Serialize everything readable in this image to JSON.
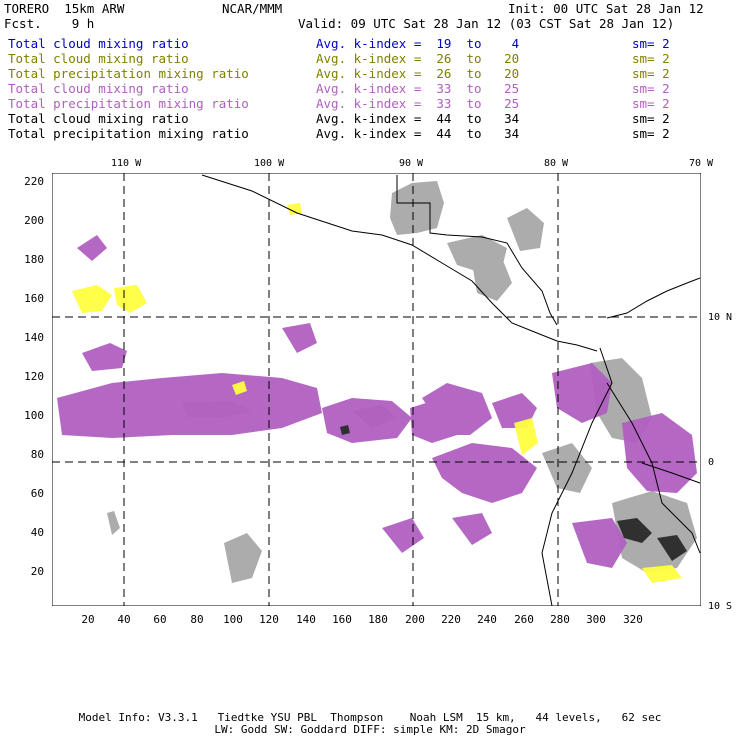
{
  "header": {
    "model": "TORERO  15km ARW",
    "center": "NCAR/MMM",
    "init": "Init: 00 UTC Sat 28 Jan 12",
    "fcst": "Fcst.    9 h",
    "valid": "Valid: 09 UTC Sat 28 Jan 12 (03 CST Sat 28 Jan 12)"
  },
  "legend": [
    {
      "name": "Total cloud mixing ratio",
      "stat": "Avg. k-index =  19  to    4",
      "sm": "sm= 2",
      "color": "#0000cc"
    },
    {
      "name": "Total cloud mixing ratio",
      "stat": "Avg. k-index =  26  to   20",
      "sm": "sm= 2",
      "color": "#808000"
    },
    {
      "name": "Total precipitation mixing ratio",
      "stat": "Avg. k-index =  26  to   20",
      "sm": "sm= 2",
      "color": "#808000"
    },
    {
      "name": "Total cloud mixing ratio",
      "stat": "Avg. k-index =  33  to   25",
      "sm": "sm= 2",
      "color": "#b060c0"
    },
    {
      "name": "Total precipitation mixing ratio",
      "stat": "Avg. k-index =  33  to   25",
      "sm": "sm= 2",
      "color": "#b060c0"
    },
    {
      "name": "Total cloud mixing ratio",
      "stat": "Avg. k-index =  44  to   34",
      "sm": "sm= 2",
      "color": "#000000"
    },
    {
      "name": "Total precipitation mixing ratio",
      "stat": "Avg. k-index =  44  to   34",
      "sm": "sm= 2",
      "color": "#000000"
    }
  ],
  "axes": {
    "x_ticks": [
      "20",
      "40",
      "60",
      "80",
      "100",
      "120",
      "140",
      "160",
      "180",
      "200",
      "220",
      "240",
      "260",
      "280",
      "300",
      "320"
    ],
    "y_ticks": [
      "20",
      "40",
      "60",
      "80",
      "100",
      "120",
      "140",
      "160",
      "180",
      "200",
      "220"
    ],
    "lon_labels": [
      "110 W",
      "100 W",
      "90 W",
      "80 W",
      "70 W"
    ],
    "lat_labels": [
      "10 N",
      "0",
      "10 S"
    ]
  },
  "footer": {
    "line1": "Model Info: V3.3.1   Tiedtke YSU PBL  Thompson    Noah LSM  15 km,   44 levels,   62 sec",
    "line2": "LW: Godd SW: Goddard DIFF: simple KM: 2D Smagor"
  },
  "colors": {
    "purple": "#b060c0",
    "yellow": "#ffff40",
    "gray": "#a8a8a8",
    "dark": "#303030",
    "light_blue": "#c0e8f8"
  }
}
